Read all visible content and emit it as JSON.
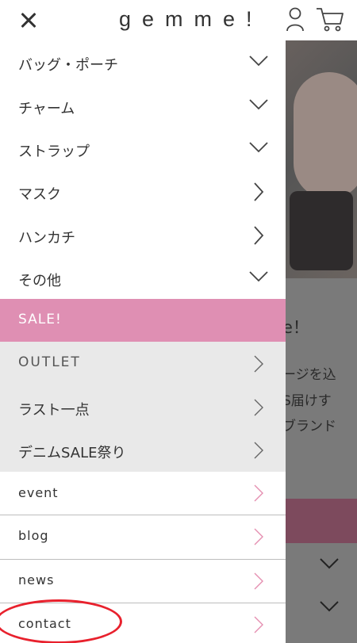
{
  "header": {
    "logo": "gemme!",
    "close_icon": "close-icon",
    "user_icon": "user-icon",
    "cart_icon": "cart-icon"
  },
  "background": {
    "text_lines": [
      "e！",
      "ージを込",
      "S届けす",
      "ブランド"
    ]
  },
  "menu": {
    "items": [
      {
        "label": "バッグ・ポーチ",
        "icon": "chevron-down-icon"
      },
      {
        "label": "チャーム",
        "icon": "chevron-down-icon"
      },
      {
        "label": "ストラップ",
        "icon": "chevron-down-icon"
      },
      {
        "label": "マスク",
        "icon": "chevron-right-icon"
      },
      {
        "label": "ハンカチ",
        "icon": "chevron-right-icon"
      },
      {
        "label": "その他",
        "icon": "chevron-down-icon"
      },
      {
        "label": "SALE!",
        "icon": ""
      },
      {
        "label": "OUTLET",
        "icon": "chevron-right-icon"
      },
      {
        "label": "ラスト一点",
        "icon": "chevron-right-icon"
      },
      {
        "label": "デニムSALE祭り",
        "icon": "chevron-right-icon"
      },
      {
        "label": "event",
        "icon": "chevron-right-icon"
      },
      {
        "label": "blog",
        "icon": "chevron-right-icon"
      },
      {
        "label": "news",
        "icon": "chevron-right-icon"
      },
      {
        "label": "contact",
        "icon": "chevron-right-icon"
      }
    ]
  },
  "colors": {
    "sale_bg": "#df8fb3",
    "gray_bg": "#e9e9e9",
    "pink_chevron": "#e58fb0",
    "highlight_oval": "#e8212d"
  }
}
